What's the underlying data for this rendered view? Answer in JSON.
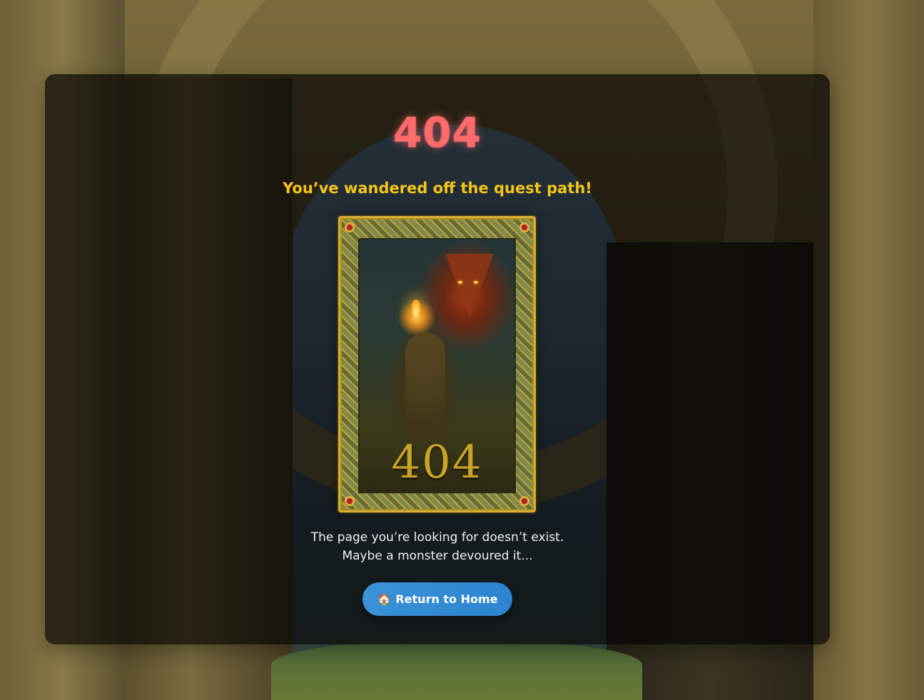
{
  "error": {
    "code": "404",
    "subtitle": "You’ve wandered off the quest path!",
    "card_number": "404",
    "message_line1": "The page you’re looking for doesn’t exist.",
    "message_line2": "Maybe a monster devoured it..."
  },
  "actions": {
    "home_button_label": "Return to Home",
    "home_icon": "🏠"
  },
  "colors": {
    "code": "#ff6b6b",
    "subtitle": "#f5c518",
    "button": "#2d84cf",
    "card_frame": "#d4af37"
  }
}
